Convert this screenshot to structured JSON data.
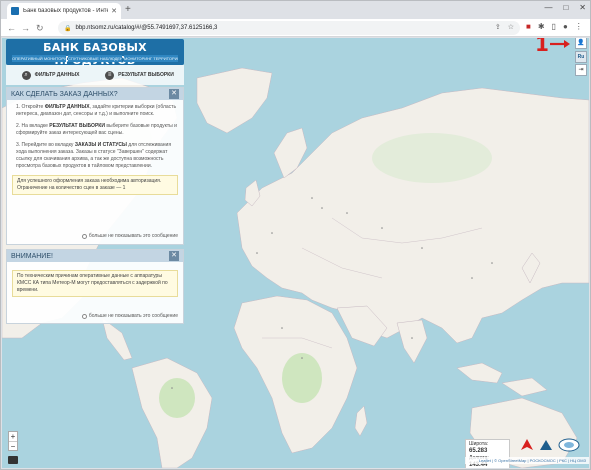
{
  "browser": {
    "tab_title": "Банк базовых продуктов - Инте",
    "url": "bbp.ntsomz.ru/catalog/#/@55.7491697,37.6125166,3",
    "new_tab": "+",
    "back": "←",
    "forward": "→",
    "reload": "↻",
    "minimize": "—",
    "maximize": "□",
    "close": "✕"
  },
  "logo": {
    "title": "БАНК БАЗОВЫХ ПРОДУКТОВ",
    "sub_items": [
      "ОПЕРАТИВНЫЙ МОНИТОРИНГ",
      "СПУТНИКОВЫЕ НАБЛЮДЕНИЯ",
      "МОНИТОРИНГ ТЕРРИТОРИЙ"
    ]
  },
  "filters": {
    "data_filter": "ФИЛЬТР ДАННЫХ",
    "result": "РЕЗУЛЬТАТ ВЫБОРКИ"
  },
  "how_to_panel": {
    "title": "КАК СДЕЛАТЬ ЗАКАЗ ДАННЫХ?",
    "step1_prefix": "1. Откройте ",
    "step1_bold": "ФИЛЬТР ДАННЫХ",
    "step1_rest": ", задайте критерии выборки (область интереса, диапазон дат, сенсоры и т.д.) и выполните поиск.",
    "step2_prefix": "2. На вкладке ",
    "step2_bold": "РЕЗУЛЬТАТ ВЫБОРКИ",
    "step2_rest": " выберите базовые продукты и сформируйте заказ интересующей вас сцены.",
    "step3_prefix": "3. Перейдите во вкладку ",
    "step3_bold": "ЗАКАЗЫ И СТАТУСЫ",
    "step3_rest": " для отслеживания хода выполнения заказа. Заказы в статусе \"Завершен\" содержат ссылку для скачивания архива, а так же доступна возможность просмотра базовых продуктов в тайловом представлении.",
    "note": "Для успешного оформления заказа необходима авторизация. Ограничение на количество сцен в заказе — 1",
    "dont_show": "больше не показывать это сообщение"
  },
  "warning_panel": {
    "title": "ВНИМАНИЕ!",
    "note": "По техническим причинам оперативные данные с аппаратуры КМСС КА типа Метеор-М могут предоставляться с задержкой по времени.",
    "dont_show": "больше не показывать это сообщение"
  },
  "right_controls": {
    "user_icon": "user-icon",
    "language": "Ru",
    "logout_icon": "logout-icon",
    "callout": "1"
  },
  "coords": {
    "lat_label": "Широта:",
    "lat_value": "65.283",
    "lon_label": "Долгота:",
    "lon_value": "143.44"
  },
  "attribution": "Leaflet | © OpenStreetMap | РОСКОСМОС | РКС | НЦ ОМЗ",
  "zoom": {
    "in": "+",
    "out": "−"
  }
}
